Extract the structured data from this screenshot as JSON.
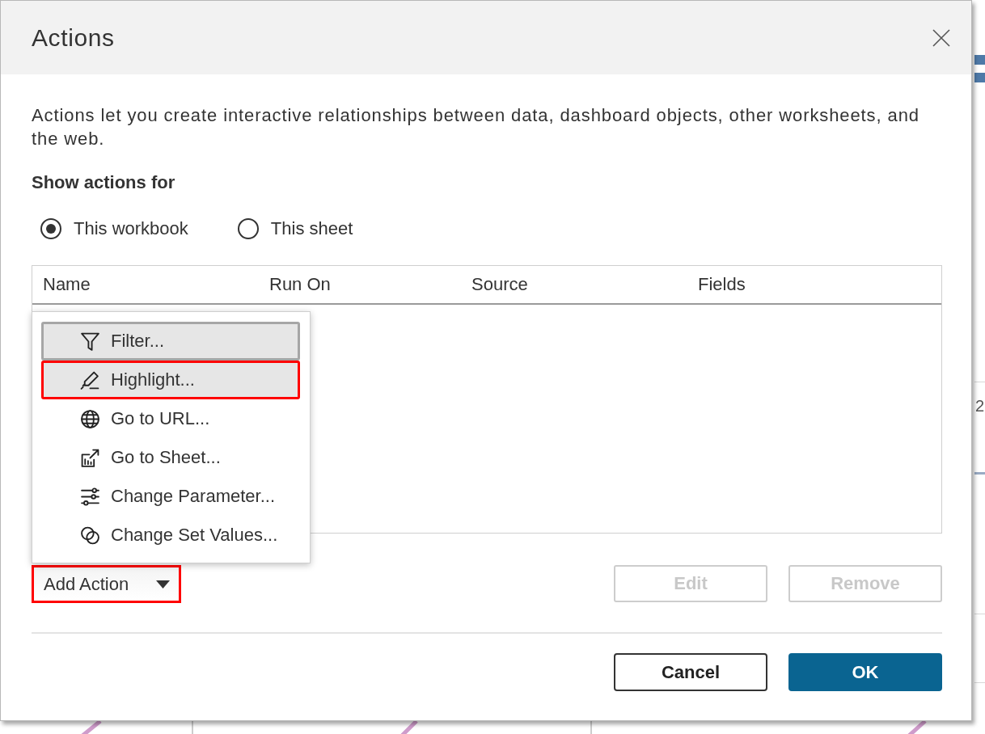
{
  "dialog": {
    "title": "Actions"
  },
  "description": "Actions let you create interactive relationships between data, dashboard objects, other worksheets, and the web.",
  "show_actions_for": {
    "label": "Show actions for",
    "options": [
      {
        "label": "This workbook",
        "selected": true
      },
      {
        "label": "This sheet",
        "selected": false
      }
    ]
  },
  "actions_table": {
    "columns": [
      "Name",
      "Run On",
      "Source",
      "Fields"
    ]
  },
  "add_action": {
    "label": "Add Action",
    "expanded": true,
    "annotated": true
  },
  "add_action_menu": [
    {
      "kind": "filter",
      "label": "Filter...",
      "focused": true,
      "hovered": false,
      "annotated": false
    },
    {
      "kind": "highlight",
      "label": "Highlight...",
      "focused": false,
      "hovered": true,
      "annotated": true
    },
    {
      "kind": "url",
      "label": "Go to URL...",
      "focused": false,
      "hovered": false,
      "annotated": false
    },
    {
      "kind": "sheet",
      "label": "Go to Sheet...",
      "focused": false,
      "hovered": false,
      "annotated": false
    },
    {
      "kind": "parameter",
      "label": "Change Parameter...",
      "focused": false,
      "hovered": false,
      "annotated": false
    },
    {
      "kind": "set",
      "label": "Change Set Values...",
      "focused": false,
      "hovered": false,
      "annotated": false
    }
  ],
  "action_buttons": [
    {
      "label": "Edit",
      "disabled": true
    },
    {
      "label": "Remove",
      "disabled": true
    }
  ],
  "footer_buttons": [
    {
      "kind": "secondary",
      "label": "Cancel"
    },
    {
      "kind": "primary",
      "label": "OK"
    }
  ],
  "backdrop": {
    "axis_label": "2"
  }
}
